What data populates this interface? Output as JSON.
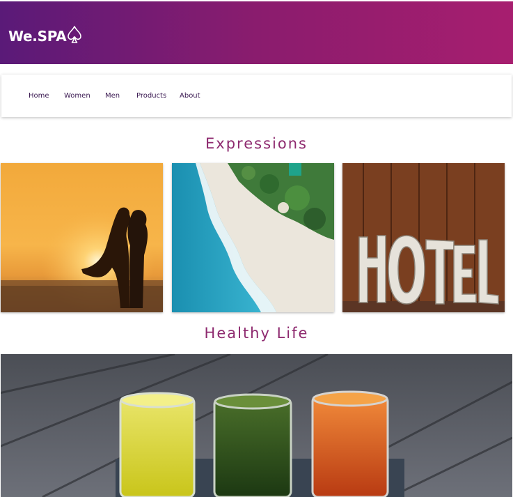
{
  "header": {
    "brand": "We.SPA",
    "logo_icon": "spade-outline-icon",
    "gradient": [
      "#5a1a78",
      "#a71e6f"
    ]
  },
  "nav": {
    "items": [
      "Home",
      "Women",
      "Men",
      "Products",
      "About"
    ]
  },
  "sections": [
    {
      "title": "Expressions",
      "images": [
        "sunset-couple-beach",
        "aerial-beach-shoreline",
        "hotel-sign-wooden-wall"
      ]
    },
    {
      "title": "Healthy Life",
      "images": [
        "juice-shots-wooden-table"
      ]
    }
  ]
}
